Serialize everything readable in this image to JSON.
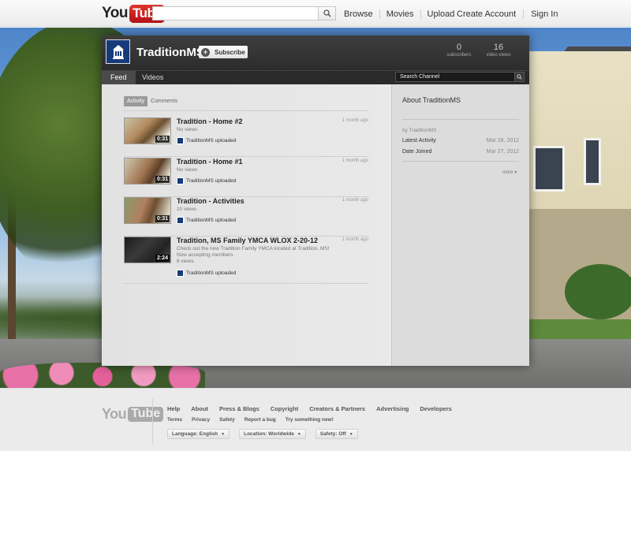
{
  "masthead": {
    "logo_you": "You",
    "logo_tube": "Tube",
    "search_placeholder": "",
    "nav": [
      "Browse",
      "Movies",
      "Upload"
    ],
    "account": [
      "Create Account",
      "Sign In"
    ]
  },
  "channel": {
    "title": "TraditionMS",
    "subscribe_label": "Subscribe",
    "stats": {
      "subscribers_value": "0",
      "subscribers_label": "subscribers",
      "views_value": "16",
      "views_label": "video views"
    },
    "tabs": [
      "Feed",
      "Videos"
    ],
    "search_placeholder": "Search Channel",
    "subtabs": [
      "Activity",
      "Comments"
    ]
  },
  "feed": [
    {
      "title": "Tradition - Home #2",
      "time": "1 month ago",
      "desc": "",
      "views": "No views",
      "duration": "0:31",
      "uploader": "TraditionMS uploaded"
    },
    {
      "title": "Tradition - Home #1",
      "time": "1 month ago",
      "desc": "",
      "views": "No views",
      "duration": "0:31",
      "uploader": "TraditionMS uploaded"
    },
    {
      "title": "Tradition - Activities",
      "time": "1 month ago",
      "desc": "",
      "views": "10 views",
      "duration": "0:31",
      "uploader": "TraditionMS uploaded"
    },
    {
      "title": "Tradition, MS Family YMCA WLOX 2-20-12",
      "time": "1 month ago",
      "desc": "Check out the new Tradition Family YMCA located at Tradition, MS!",
      "desc2": "Now accepting members.",
      "views": "6 views",
      "duration": "2:24",
      "uploader": "TraditionMS uploaded"
    }
  ],
  "about": {
    "title": "About TraditionMS",
    "by": "by TraditionMS",
    "latest_activity_label": "Latest Activity",
    "latest_activity_value": "Mar 28, 2012",
    "date_joined_label": "Date Joined",
    "date_joined_value": "Mar 27, 2012",
    "more": "more"
  },
  "footer": {
    "logo_you": "You",
    "logo_tube": "Tube",
    "row1": [
      "Help",
      "About",
      "Press & Blogs",
      "Copyright",
      "Creators & Partners",
      "Advertising",
      "Developers"
    ],
    "row2": [
      "Terms",
      "Privacy",
      "Safety",
      "Report a bug",
      "Try something new!"
    ],
    "language": "Language: English",
    "location": "Location: Worldwide",
    "safety": "Safety: Off"
  }
}
